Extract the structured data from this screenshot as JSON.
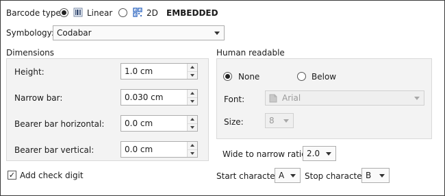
{
  "barcode_type": {
    "label": "Barcode type:",
    "options": [
      {
        "label": "Linear",
        "selected": true,
        "icon": "linear-barcode-icon"
      },
      {
        "label": "2D",
        "selected": false,
        "icon": "qr-code-icon"
      }
    ],
    "embedded_label": "EMBEDDED"
  },
  "symbology": {
    "label": "Symbology:",
    "value": "Codabar"
  },
  "dimensions": {
    "title": "Dimensions",
    "fields": [
      {
        "label": "Height:",
        "value": "1.0 cm"
      },
      {
        "label": "Narrow bar:",
        "value": "0.030 cm"
      },
      {
        "label": "Bearer bar horizontal:",
        "value": "0.0 cm"
      },
      {
        "label": "Bearer bar vertical:",
        "value": "0.0 cm"
      }
    ]
  },
  "check_digit": {
    "label": "Add check digit",
    "checked": true,
    "mark": "✓"
  },
  "human_readable": {
    "title": "Human readable",
    "options": [
      {
        "label": "None",
        "selected": true
      },
      {
        "label": "Below",
        "selected": false
      }
    ],
    "font_label": "Font:",
    "font_value": "Arial",
    "size_label": "Size:",
    "size_value": "8"
  },
  "ratio": {
    "label": "Wide to narrow ratio:",
    "value": "2.0"
  },
  "start_char": {
    "label": "Start character:",
    "value": "A"
  },
  "stop_char": {
    "label": "Stop character:",
    "value": "B"
  },
  "colors": {
    "group_bg": "#f3f3f3",
    "disabled_text": "#9a9a9a",
    "qr_blue": "#3a6fc4"
  }
}
